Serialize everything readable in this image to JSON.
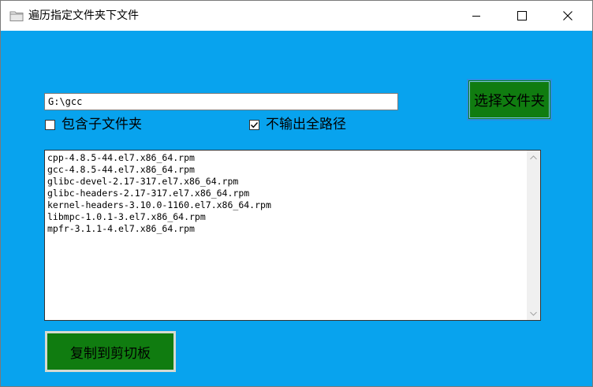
{
  "window": {
    "title": "遍历指定文件夹下文件",
    "icon": "folder-icon",
    "controls": {
      "minimize_icon": "minimize-icon",
      "maximize_icon": "maximize-icon",
      "close_icon": "close-icon"
    }
  },
  "colors": {
    "client_background": "#08a3ee",
    "button_background": "#107c10",
    "accent_border": "#2b8de0"
  },
  "path_input": {
    "value": "G:\\gcc"
  },
  "checkboxes": [
    {
      "label": "包含子文件夹",
      "checked": false
    },
    {
      "label": "不输出全路径",
      "checked": true
    }
  ],
  "select_folder_button": {
    "label": "选择文件夹"
  },
  "file_list": {
    "lines": [
      "cpp-4.8.5-44.el7.x86_64.rpm",
      "gcc-4.8.5-44.el7.x86_64.rpm",
      "glibc-devel-2.17-317.el7.x86_64.rpm",
      "glibc-headers-2.17-317.el7.x86_64.rpm",
      "kernel-headers-3.10.0-1160.el7.x86_64.rpm",
      "libmpc-1.0.1-3.el7.x86_64.rpm",
      "mpfr-3.1.1-4.el7.x86_64.rpm"
    ],
    "scroll_up_icon": "scroll-up-arrow-icon",
    "scroll_down_icon": "scroll-down-arrow-icon"
  },
  "copy_button": {
    "label": "复制到剪切板"
  }
}
